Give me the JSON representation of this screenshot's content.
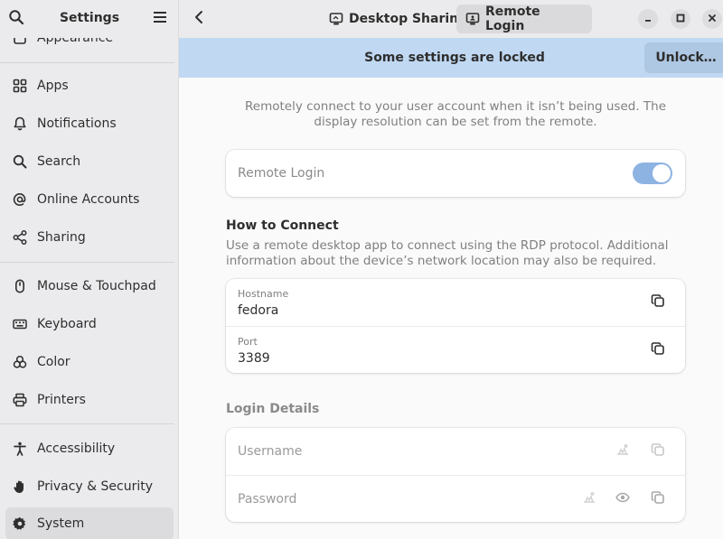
{
  "sidebar": {
    "title": "Settings",
    "partial_item": "Appearance",
    "items": [
      {
        "label": "Apps",
        "icon": "apps-icon"
      },
      {
        "label": "Notifications",
        "icon": "bell-icon"
      },
      {
        "label": "Search",
        "icon": "search-icon"
      },
      {
        "label": "Online Accounts",
        "icon": "at-icon"
      },
      {
        "label": "Sharing",
        "icon": "share-icon"
      },
      {
        "label": "Mouse & Touchpad",
        "icon": "mouse-icon"
      },
      {
        "label": "Keyboard",
        "icon": "keyboard-icon"
      },
      {
        "label": "Color",
        "icon": "color-icon"
      },
      {
        "label": "Printers",
        "icon": "printer-icon"
      },
      {
        "label": "Accessibility",
        "icon": "accessibility-icon"
      },
      {
        "label": "Privacy & Security",
        "icon": "hand-icon"
      },
      {
        "label": "System",
        "icon": "gear-icon"
      }
    ]
  },
  "header": {
    "tabs": [
      {
        "label": "Desktop Sharing",
        "icon": "monitor-icon"
      },
      {
        "label": "Remote Login",
        "icon": "remote-login-icon"
      }
    ]
  },
  "banner": {
    "message": "Some settings are locked",
    "unlock_label": "Unlock…"
  },
  "main": {
    "description": "Remotely connect to your user account when it isn’t being used. The display resolution can be set from the remote.",
    "remote_login_label": "Remote Login",
    "remote_login_enabled": true,
    "how_to_connect": {
      "title": "How to Connect",
      "description": "Use a remote desktop app to connect using the RDP protocol. Additional information about the device’s network location may also be required.",
      "hostname_label": "Hostname",
      "hostname_value": "fedora",
      "port_label": "Port",
      "port_value": "3389"
    },
    "login_details": {
      "title": "Login Details",
      "username_placeholder": "Username",
      "password_placeholder": "Password"
    }
  },
  "colors": {
    "accent": "#8db3e2",
    "banner": "#c0d8f2",
    "sidebar": "#ebebed"
  }
}
